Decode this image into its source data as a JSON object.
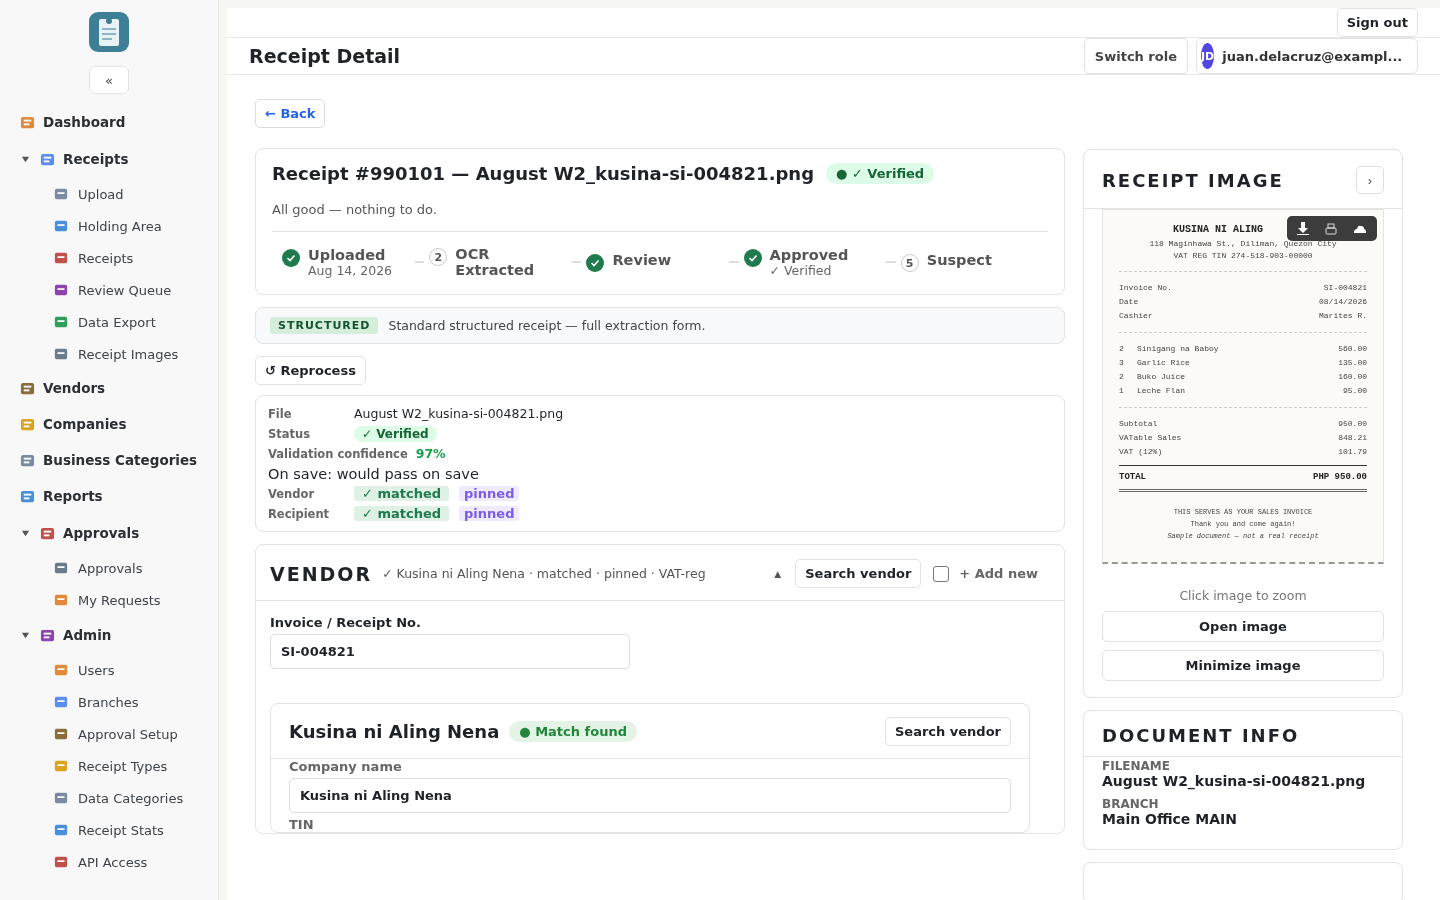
{
  "sidebar": {
    "collapse": "«",
    "items": [
      {
        "label": "Dashboard"
      },
      {
        "label": "Receipts",
        "expanded": true,
        "children": [
          {
            "label": "Upload"
          },
          {
            "label": "Holding Area"
          },
          {
            "label": "Receipts"
          },
          {
            "label": "Review Queue"
          },
          {
            "label": "Data Export"
          },
          {
            "label": "Receipt Images"
          }
        ]
      },
      {
        "label": "Vendors"
      },
      {
        "label": "Companies"
      },
      {
        "label": "Business Categories"
      },
      {
        "label": "Reports"
      },
      {
        "label": "Approvals",
        "expanded": true,
        "children": [
          {
            "label": "Approvals"
          },
          {
            "label": "My Requests"
          }
        ]
      },
      {
        "label": "Admin",
        "expanded": true,
        "children": [
          {
            "label": "Users"
          },
          {
            "label": "Branches"
          },
          {
            "label": "Approval Setup"
          },
          {
            "label": "Receipt Types"
          },
          {
            "label": "Data Categories"
          },
          {
            "label": "Receipt Stats"
          },
          {
            "label": "API Access"
          }
        ]
      }
    ]
  },
  "topbar": {
    "sign_out": "Sign out"
  },
  "header": {
    "title": "Receipt Detail",
    "switch_role": "Switch role",
    "avatar": "JD",
    "user": "juan.delacruz@exampl..."
  },
  "back": "← Back",
  "receipt": {
    "title": "Receipt #990101 — August W2_kusina-si-004821.png",
    "badge": "● ✓ Verified",
    "note": "All good — nothing to do.",
    "steps": [
      {
        "label": "Uploaded",
        "done": true,
        "sub": "Aug 14, 2026"
      },
      {
        "label": "OCR Extracted",
        "done": false,
        "number": "2"
      },
      {
        "label": "Review",
        "done": true
      },
      {
        "label": "Approved",
        "done": true,
        "sub": "✓ Verified"
      },
      {
        "label": "Suspect",
        "done": false,
        "number": "5"
      }
    ]
  },
  "type_bar": {
    "tag": "STRUCTURED",
    "text": "Standard structured receipt — full extraction form."
  },
  "reprocess": "↺ Reprocess",
  "summary": [
    {
      "kind": "text",
      "label": "File",
      "value": "August W2_kusina-si-004821.png"
    },
    {
      "kind": "badge",
      "label": "Status",
      "value": "✓ Verified"
    },
    {
      "kind": "percent",
      "label": "Validation confidence",
      "value": "97%"
    },
    {
      "kind": "line",
      "label": "On save: would pass on save"
    },
    {
      "kind": "match",
      "label": "Vendor",
      "value": "✓ matched",
      "extra": "pinned"
    },
    {
      "kind": "match",
      "label": "Recipient",
      "value": "✓ matched",
      "extra": "pinned"
    }
  ],
  "vendor": {
    "title": "VENDOR",
    "summary": "✓ Kusina ni Aling Nena · matched · pinned · VAT-reg",
    "toggle": "▲",
    "search": "Search vendor",
    "add_new": "+ Add new",
    "add_checked": false,
    "invoice_label": "Invoice / Receipt No.",
    "invoice_value": "SI-004821",
    "card": {
      "name": "Kusina ni Aling Nena",
      "badge": "● Match found",
      "search": "Search vendor",
      "company_label": "Company name",
      "company_value": "Kusina ni Aling Nena",
      "tin_label": "TIN"
    }
  },
  "receipt_image": {
    "title": "RECEIPT IMAGE",
    "next": "›",
    "doc": {
      "store": "KUSINA NI ALING",
      "address": "118 Maginhawa St., Diliman, Quezon City",
      "tin": "VAT REG TIN 274-518-903-00000",
      "meta": [
        [
          "Invoice No.",
          "SI-004821"
        ],
        [
          "Date",
          "08/14/2026"
        ],
        [
          "Cashier",
          "Marites R."
        ]
      ],
      "items": [
        [
          "2",
          "Sinigang na Baboy",
          "560.00"
        ],
        [
          "3",
          "Garlic Rice",
          "135.00"
        ],
        [
          "2",
          "Buko Juice",
          "160.00"
        ],
        [
          "1",
          "Leche Flan",
          "95.00"
        ]
      ],
      "totals": [
        [
          "Subtotal",
          "950.00"
        ],
        [
          "VATable Sales",
          "848.21"
        ],
        [
          "VAT (12%)",
          "101.79"
        ]
      ],
      "total": [
        "TOTAL",
        "PHP 950.00"
      ],
      "footer": [
        "THIS SERVES AS YOUR SALES INVOICE",
        "Thank you and come again!"
      ],
      "disclaimer": "Sample document — not a real receipt"
    },
    "hint": "Click image to zoom",
    "open": "Open image",
    "minimize": "Minimize image"
  },
  "doc_info": {
    "title": "DOCUMENT INFO",
    "fields": [
      {
        "label": "FILENAME",
        "value": "August W2_kusina-si-004821.png"
      },
      {
        "label": "BRANCH",
        "value": "Main Office MAIN"
      }
    ]
  }
}
